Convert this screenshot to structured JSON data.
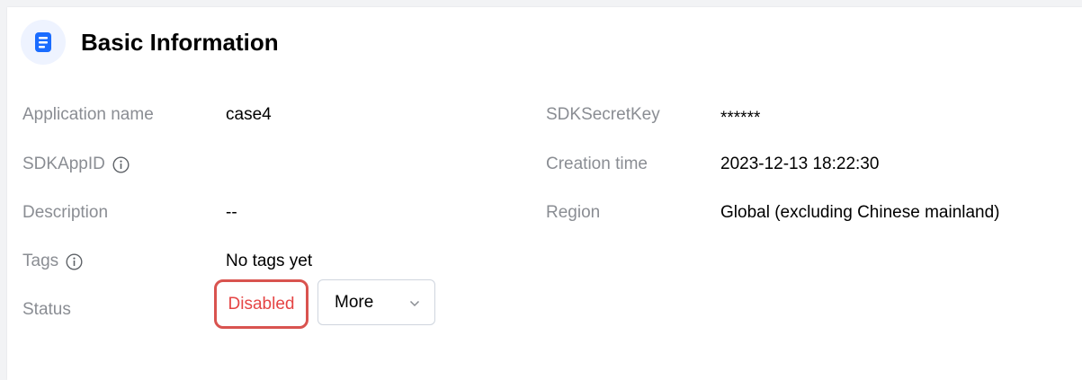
{
  "header": {
    "title": "Basic Information",
    "icon": "document-icon",
    "icon_color": "#1a6cff"
  },
  "fields": {
    "application_name": {
      "label": "Application name",
      "value": "case4"
    },
    "sdkappid": {
      "label": "SDKAppID",
      "value": ""
    },
    "description": {
      "label": "Description",
      "value": "--"
    },
    "tags": {
      "label": "Tags",
      "value": "No tags yet"
    },
    "status": {
      "label": "Status",
      "value": "Disabled",
      "color": "#e54545"
    },
    "sdksecretkey": {
      "label": "SDKSecretKey",
      "value": "******"
    },
    "creation_time": {
      "label": "Creation time",
      "value": "2023-12-13 18:22:30"
    },
    "region": {
      "label": "Region",
      "value": "Global (excluding Chinese mainland)"
    }
  },
  "actions": {
    "more_label": "More"
  }
}
